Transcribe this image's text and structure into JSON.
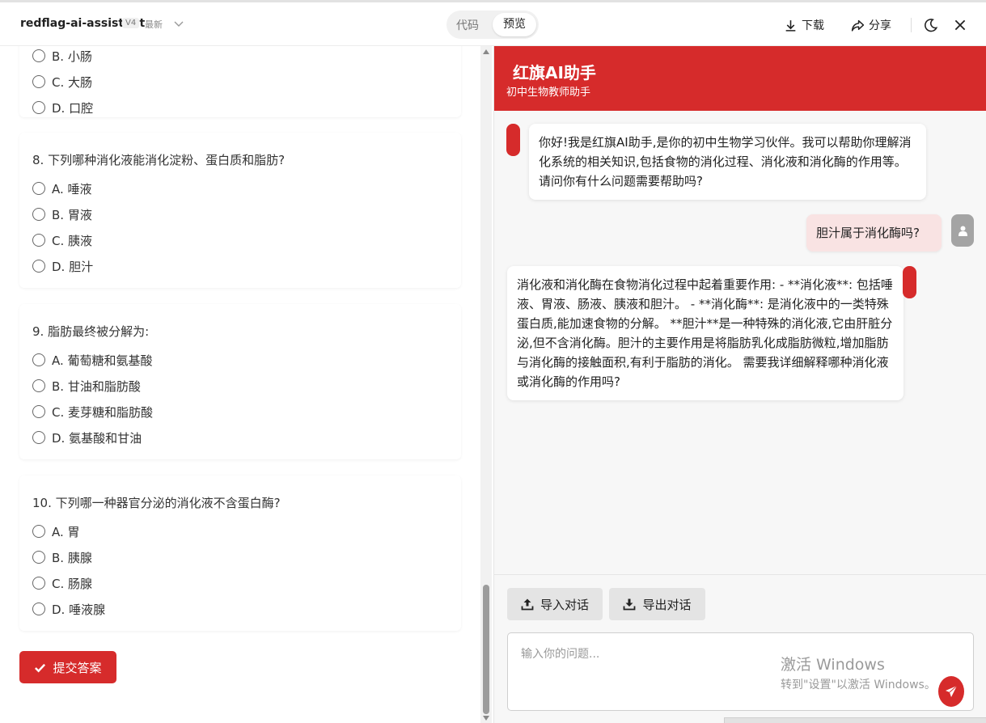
{
  "topbar": {
    "app_name": "redflag-ai-assistant",
    "version": "V4",
    "latest": "最新",
    "tab_code": "代码",
    "tab_preview": "预览",
    "download": "下载",
    "share": "分享"
  },
  "quiz": {
    "partial_question": {
      "options": [
        "B. 小肠",
        "C. 大肠",
        "D. 口腔"
      ]
    },
    "questions": [
      {
        "title": "8. 下列哪种消化液能消化淀粉、蛋白质和脂肪?",
        "options": [
          "A. 唾液",
          "B. 胃液",
          "C. 胰液",
          "D. 胆汁"
        ]
      },
      {
        "title": "9. 脂肪最终被分解为:",
        "options": [
          "A. 葡萄糖和氨基酸",
          "B. 甘油和脂肪酸",
          "C. 麦芽糖和脂肪酸",
          "D. 氨基酸和甘油"
        ]
      },
      {
        "title": "10. 下列哪一种器官分泌的消化液不含蛋白酶?",
        "options": [
          "A. 胃",
          "B. 胰腺",
          "C. 肠腺",
          "D. 唾液腺"
        ]
      }
    ],
    "submit_label": "提交答案"
  },
  "chat": {
    "title": "红旗AI助手",
    "subtitle": "初中生物教师助手",
    "messages": [
      {
        "role": "assistant",
        "text": "你好!我是红旗AI助手,是你的初中生物学习伙伴。我可以帮助你理解消化系统的相关知识,包括食物的消化过程、消化液和消化酶的作用等。请问你有什么问题需要帮助吗?"
      },
      {
        "role": "user",
        "text": "胆汁属于消化酶吗?"
      },
      {
        "role": "assistant",
        "text": "消化液和消化酶在食物消化过程中起着重要作用: - **消化液**: 包括唾液、胃液、肠液、胰液和胆汁。 - **消化酶**: 是消化液中的一类特殊蛋白质,能加速食物的分解。 **胆汁**是一种特殊的消化液,它由肝脏分泌,但不含消化酶。胆汁的主要作用是将脂肪乳化成脂肪微粒,增加脂肪与消化酶的接触面积,有利于脂肪的消化。 需要我详细解释哪种消化液或消化酶的作用吗?"
      }
    ],
    "import_label": "导入对话",
    "export_label": "导出对话",
    "input_placeholder": "输入你的问题..."
  },
  "watermark": {
    "title": "激活 Windows",
    "subtitle": "转到\"设置\"以激活 Windows。"
  },
  "colors": {
    "brand_red": "#d62b2b",
    "user_bubble": "#f9e3e3"
  }
}
